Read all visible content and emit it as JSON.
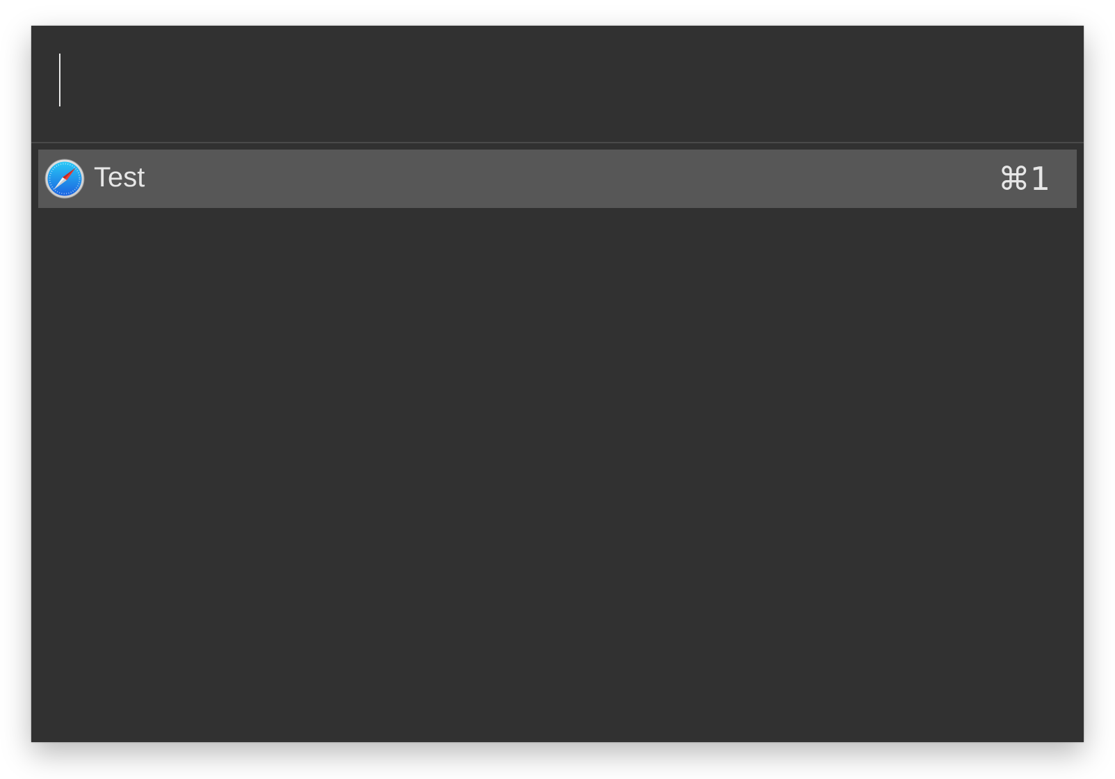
{
  "search": {
    "value": "",
    "placeholder": ""
  },
  "results": [
    {
      "title": "Test",
      "shortcut": "⌘1",
      "icon": "safari-compass-icon",
      "selected": true
    }
  ],
  "colors": {
    "window_background": "#313131",
    "selected_row": "#575757",
    "text": "#e6e6e6",
    "divider": "#4a4a4a"
  }
}
